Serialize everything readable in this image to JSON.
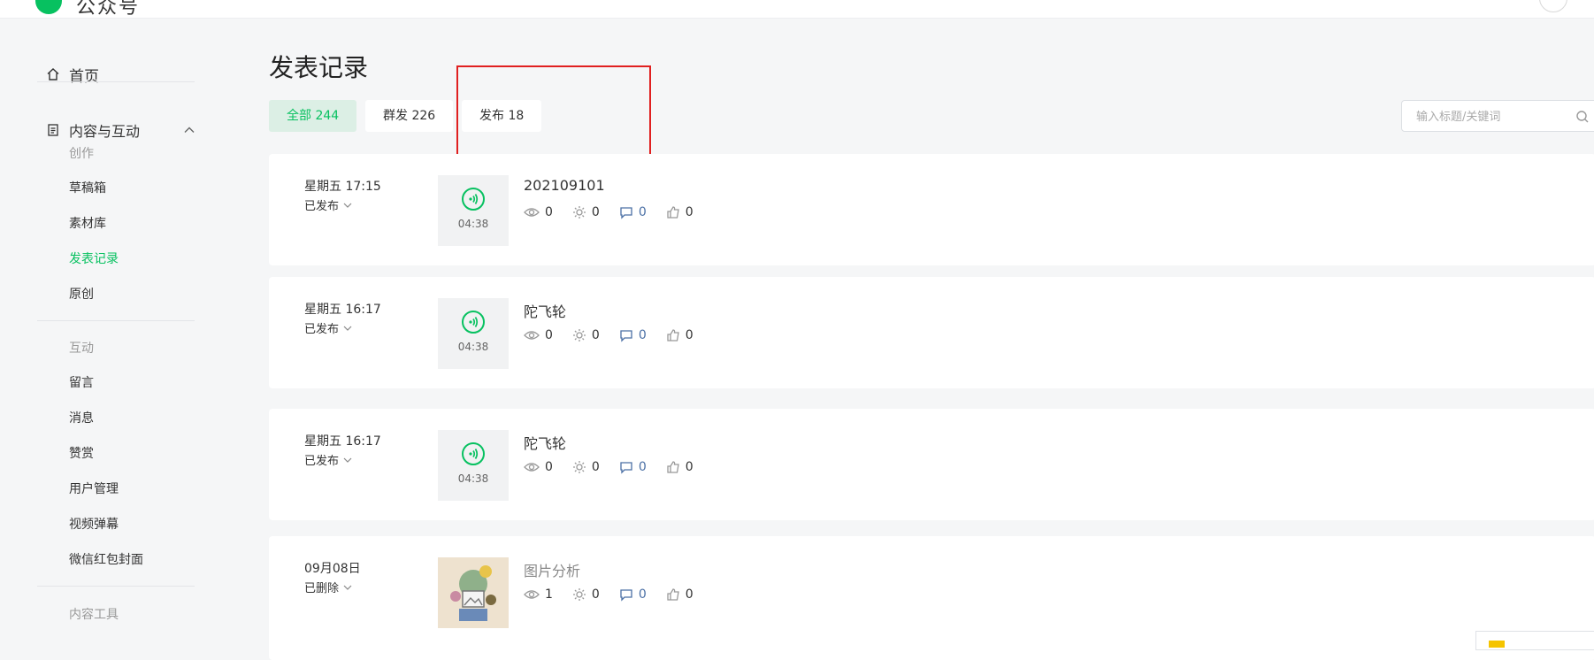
{
  "header": {
    "logo_text": "公众号"
  },
  "sidebar": {
    "home_label": "首页",
    "group_label": "内容与互动",
    "items": [
      {
        "label": "创作",
        "kind": "section"
      },
      {
        "label": "草稿箱",
        "kind": "item"
      },
      {
        "label": "素材库",
        "kind": "item"
      },
      {
        "label": "发表记录",
        "kind": "active"
      },
      {
        "label": "原创",
        "kind": "item"
      },
      {
        "label": "互动",
        "kind": "section"
      },
      {
        "label": "留言",
        "kind": "item"
      },
      {
        "label": "消息",
        "kind": "item"
      },
      {
        "label": "赞赏",
        "kind": "item"
      },
      {
        "label": "用户管理",
        "kind": "item"
      },
      {
        "label": "视频弹幕",
        "kind": "item"
      },
      {
        "label": "微信红包封面",
        "kind": "item"
      },
      {
        "label": "内容工具",
        "kind": "section"
      }
    ]
  },
  "main": {
    "title": "发表记录",
    "tabs": [
      {
        "label": "全部 244",
        "active": true
      },
      {
        "label": "群发 226",
        "active": false
      },
      {
        "label": "发布 18",
        "active": false
      }
    ],
    "search_placeholder": "输入标题/关键词",
    "records": [
      {
        "time": "星期五 17:15",
        "status": "已发布",
        "thumb": "audio",
        "duration": "04:38",
        "title": "202109101",
        "views": "0",
        "shares": "0",
        "comments": "0",
        "likes": "0"
      },
      {
        "time": "星期五 16:17",
        "status": "已发布",
        "thumb": "audio",
        "duration": "04:38",
        "title": "陀飞轮",
        "views": "0",
        "shares": "0",
        "comments": "0",
        "likes": "0"
      },
      {
        "time": "星期五 16:17",
        "status": "已发布",
        "thumb": "audio",
        "duration": "04:38",
        "title": "陀飞轮",
        "views": "0",
        "shares": "0",
        "comments": "0",
        "likes": "0"
      },
      {
        "time": "09月08日",
        "status": "已删除",
        "thumb": "image",
        "duration": "",
        "title": "图片分析",
        "views": "1",
        "shares": "0",
        "comments": "0",
        "likes": "0"
      }
    ]
  },
  "colors": {
    "accent": "#07c160",
    "highlight": "#e02020",
    "comment": "#4a6fa5"
  }
}
